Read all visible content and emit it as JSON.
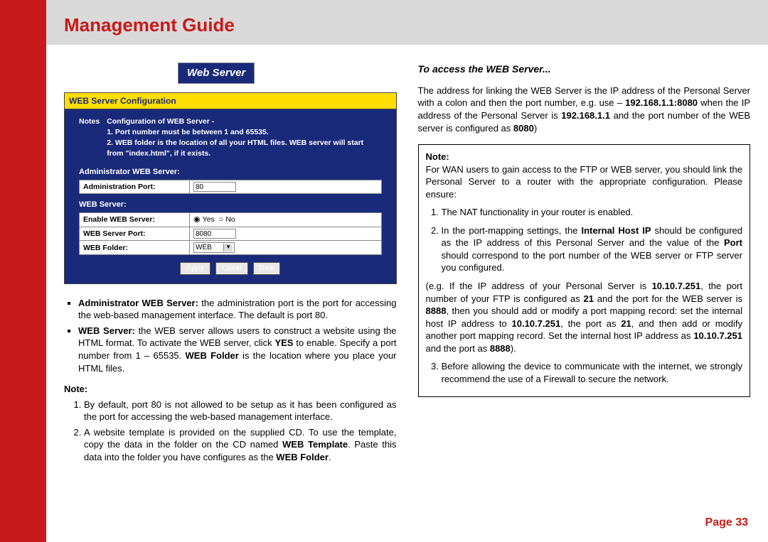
{
  "header": {
    "title": "Management Guide"
  },
  "footer": {
    "page_label": "Page 33"
  },
  "screenshot": {
    "tab_label": "Web Server",
    "panel_header": "WEB Server Configuration",
    "notes_label": "Notes",
    "notes_text": "Configuration of WEB Server -\n1. Port number must be between 1 and 65535.\n2. WEB folder is the location of all your HTML files. WEB server will start from \"index.html\", if it exists.",
    "admin_section": "Administrator WEB Server:",
    "admin_row_label": "Administration Port:",
    "admin_port_value": "80",
    "web_section": "WEB Server:",
    "enable_label": "Enable WEB Server:",
    "enable_yes": "Yes",
    "enable_no": "No",
    "port_label": "WEB Server Port:",
    "port_value": "8080",
    "folder_label": "WEB Folder:",
    "folder_value": "WEB",
    "btn_apply": "Apply",
    "btn_cancel": "Cancel",
    "btn_back": "Back"
  },
  "left": {
    "b1_bold": "Administrator WEB Server:",
    "b1_rest": " the administration port is the port for accessing the web-based management interface. The default is port 80.",
    "b2_bold": "WEB Server:",
    "b2_mid1": " the WEB server allows users to construct a website using the HTML format. To activate the WEB server, click ",
    "b2_yes": "YES",
    "b2_mid2": " to enable. Specify a port number from 1 – 65535. ",
    "b2_folder": "WEB Folder",
    "b2_end": " is the location where you place your HTML files.",
    "note_label": "Note:",
    "n1": "By default, port 80 is not allowed to be setup as it has been configured as the port for accessing the web-based management interface.",
    "n2_a": "A website template is provided on the supplied CD. To use the template, copy the data in the folder on the CD named ",
    "n2_bold": "WEB Template",
    "n2_b": ". Paste this data into the folder you have configures as the ",
    "n2_bold2": "WEB Folder",
    "n2_c": "."
  },
  "right": {
    "subhead": "To access the WEB Server...",
    "p1_a": "The address for linking the WEB Server is the IP address of the Personal Server with a colon and then the port number, e.g. use – ",
    "p1_b1": "192.168.1.1:8080",
    "p1_b": " when the IP address of the Personal Server is ",
    "p1_b2": "192.168.1.1",
    "p1_c": " and the port number of the WEB server is configured as ",
    "p1_b3": "8080",
    "p1_d": ")",
    "note_label": "Note:",
    "nb_p1": "For WAN users to gain access to the FTP or WEB server, you should link the Personal Server to a router with the appropriate configuration. Please ensure:",
    "nb_li1": "The NAT functionality in your router is enabled.",
    "nb_li2_a": "In the port-mapping settings, the ",
    "nb_li2_b1": "Internal Host IP",
    "nb_li2_b": " should be configured as the IP address of this Personal Server and the value of the ",
    "nb_li2_b2": "Port",
    "nb_li2_c": " should correspond to the port number of the WEB server or FTP server you configured.",
    "nb_p2_a": "(e.g. If the IP address of your Personal Server is ",
    "nb_p2_b1": "10.10.7.251",
    "nb_p2_b": ", the port number of your FTP is configured as ",
    "nb_p2_b2": "21",
    "nb_p2_c": " and the port for the WEB server is ",
    "nb_p2_b3": "8888",
    "nb_p2_d": ", then you should add or modify a port mapping record: set the internal host IP address to ",
    "nb_p2_b4": "10.10.7.251",
    "nb_p2_e": ", the port as ",
    "nb_p2_b5": "21",
    "nb_p2_f": ", and then add or modify another port mapping record. Set the internal host IP address as ",
    "nb_p2_b6": "10.10.7.251",
    "nb_p2_g": " and the port as ",
    "nb_p2_b7": "8888",
    "nb_p2_h": ").",
    "nb_li3": "Before allowing the device to communicate with the internet, we strongly recommend the use of a Firewall to secure the network."
  }
}
